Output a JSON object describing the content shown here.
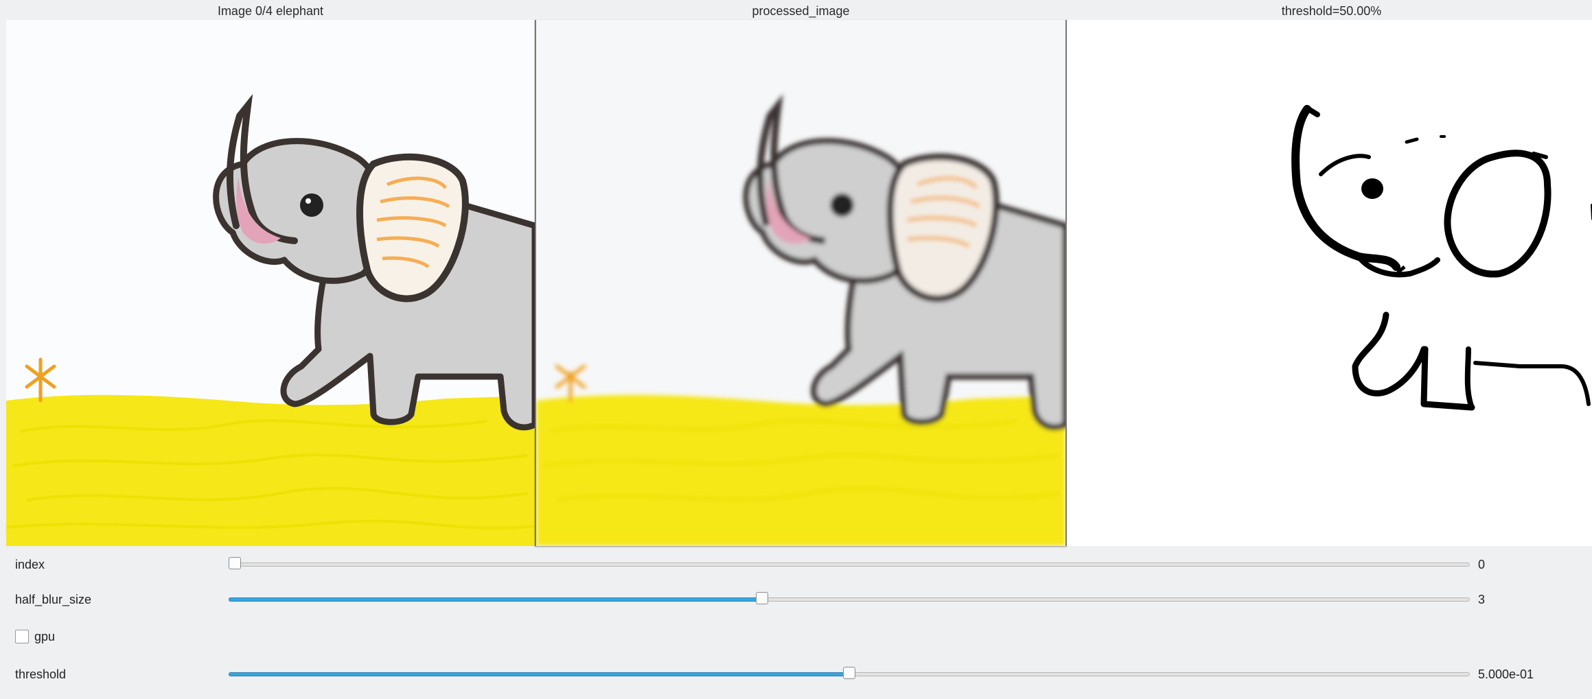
{
  "panels": {
    "original": {
      "title": "Image 0/4 elephant"
    },
    "processed": {
      "title": "processed_image"
    },
    "thresholded": {
      "title": "threshold=50.00%"
    }
  },
  "controls": {
    "index": {
      "label": "index",
      "value_text": "0",
      "fraction": 0.0
    },
    "half_blur_size": {
      "label": "half_blur_size",
      "value_text": "3",
      "fraction": 0.43
    },
    "gpu": {
      "label": "gpu",
      "checked": false
    },
    "threshold": {
      "label": "threshold",
      "value_text": "5.000e-01",
      "fraction": 0.5
    }
  },
  "colors": {
    "slider_fill": "#3aa6df",
    "grass": "#f7e81a",
    "elephant_body": "#cfcfcf",
    "outline": "#3a3330",
    "ear_inner": "#f5a33a",
    "trunk_pink": "#e3a3b8",
    "flower": "#f0a020"
  }
}
